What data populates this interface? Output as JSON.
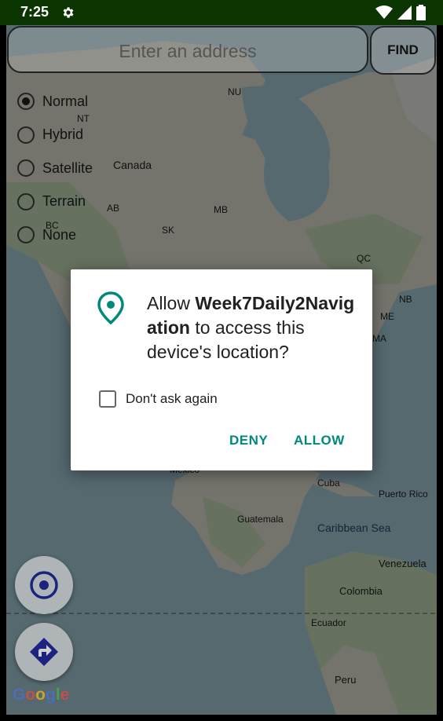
{
  "status_bar": {
    "time": "7:25",
    "icons": [
      "gear-icon",
      "wifi-icon",
      "signal-icon",
      "battery-icon"
    ]
  },
  "search": {
    "placeholder": "Enter an address",
    "find_label": "FIND"
  },
  "map_types": [
    {
      "label": "Normal",
      "checked": true
    },
    {
      "label": "Hybrid",
      "checked": false
    },
    {
      "label": "Satellite",
      "checked": false
    },
    {
      "label": "Terrain",
      "checked": false
    },
    {
      "label": "None",
      "checked": false
    }
  ],
  "map_labels": {
    "nu": "NU",
    "nt": "NT",
    "canada": "Canada",
    "ab": "AB",
    "mb": "MB",
    "sk": "SK",
    "bc": "BC",
    "qc": "QC",
    "nb": "NB",
    "me": "ME",
    "ma": "MA",
    "mexico": "Mexico",
    "cuba": "Cuba",
    "puerto_rico": "Puerto Rico",
    "guatemala": "Guatemala",
    "caribbean": "Caribbean Sea",
    "venezuela": "Venezuela",
    "colombia": "Colombia",
    "ecuador": "Ecuador",
    "peru": "Peru"
  },
  "dialog": {
    "prefix": "Allow ",
    "app_name": "Week7Daily2Navigation",
    "suffix": " to access this device's location?",
    "checkbox_label": "Don't ask again",
    "deny_label": "DENY",
    "allow_label": "ALLOW"
  },
  "google_logo": "Google",
  "colors": {
    "status_bar": "#0b3500",
    "accent": "#00897b",
    "fab_icon": "#1a237e"
  }
}
